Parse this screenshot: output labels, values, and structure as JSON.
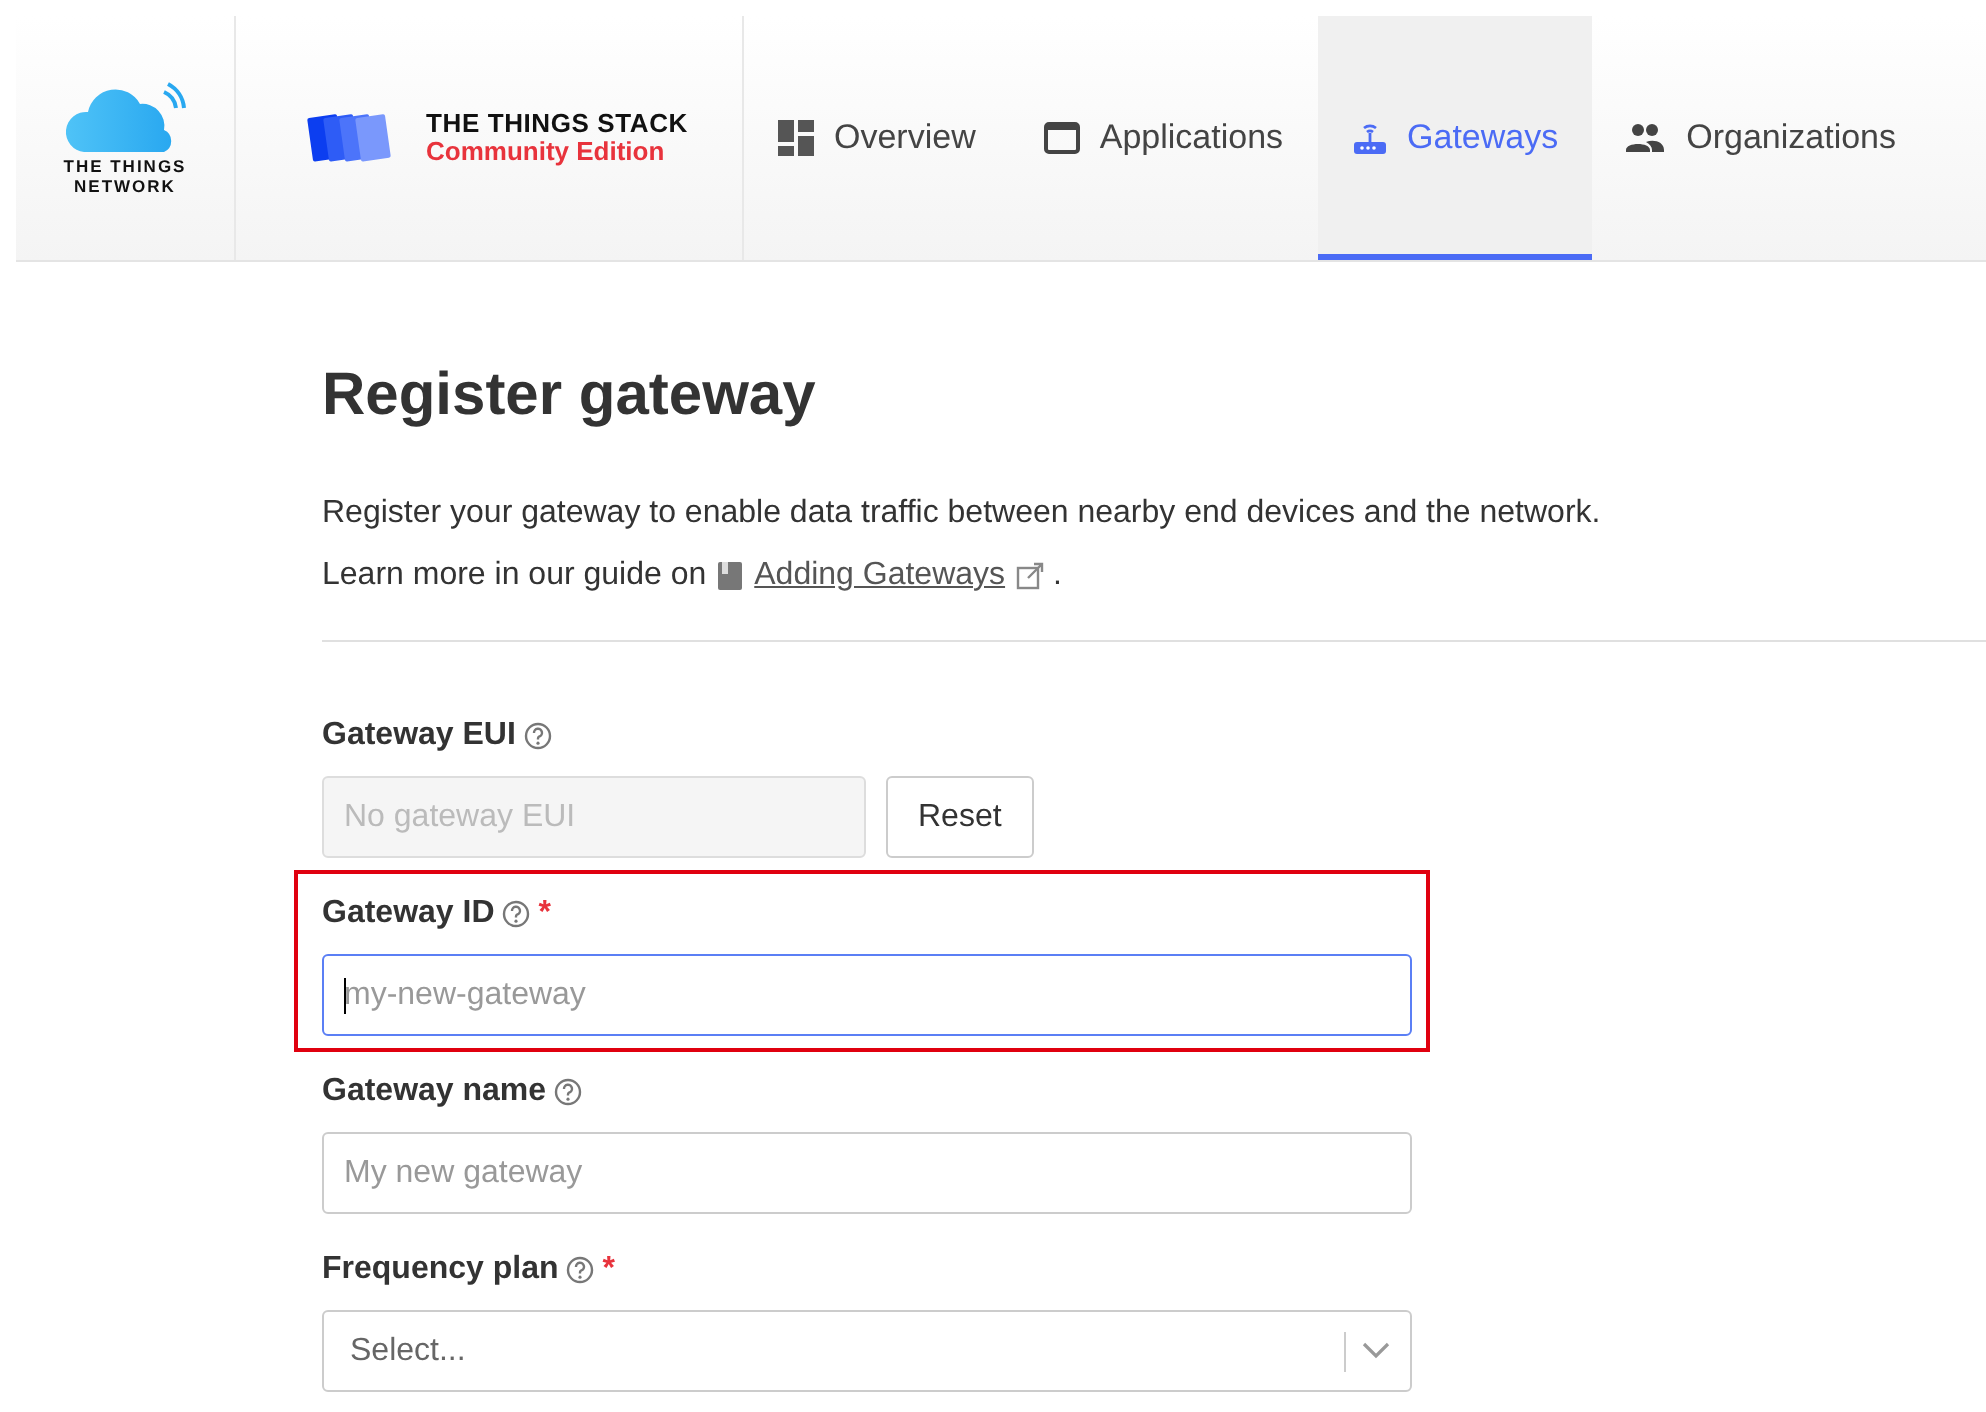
{
  "header": {
    "network_logo": [
      "THE THINGS",
      "NETWORK"
    ],
    "product": {
      "name": "THE THINGS STACK",
      "edition": "Community Edition"
    },
    "tabs": [
      {
        "label": "Overview",
        "selected": false
      },
      {
        "label": "Applications",
        "selected": false
      },
      {
        "label": "Gateways",
        "selected": true
      },
      {
        "label": "Organizations",
        "selected": false
      }
    ]
  },
  "page": {
    "title": "Register gateway",
    "description": "Register your gateway to enable data traffic between nearby end devices and the network.",
    "guide": {
      "prefix": "Learn more in our guide on",
      "link": "Adding Gateways",
      "suffix": "."
    }
  },
  "fields": [
    {
      "kind": "eui",
      "label": "Gateway EUI",
      "placeholder": "No gateway EUI",
      "disabled": true,
      "focused": false,
      "button": "Reset"
    },
    {
      "kind": "text",
      "label": "Gateway ID",
      "required_mark": "*",
      "placeholder": "my-new-gateway",
      "disabled": false,
      "focused": true,
      "highlighted": true
    },
    {
      "kind": "text",
      "label": "Gateway name",
      "placeholder": "My new gateway",
      "disabled": false,
      "focused": false
    },
    {
      "kind": "select",
      "label": "Frequency plan",
      "required_mark": "*",
      "placeholder": "Select...",
      "disabled": false,
      "focused": false
    }
  ]
}
